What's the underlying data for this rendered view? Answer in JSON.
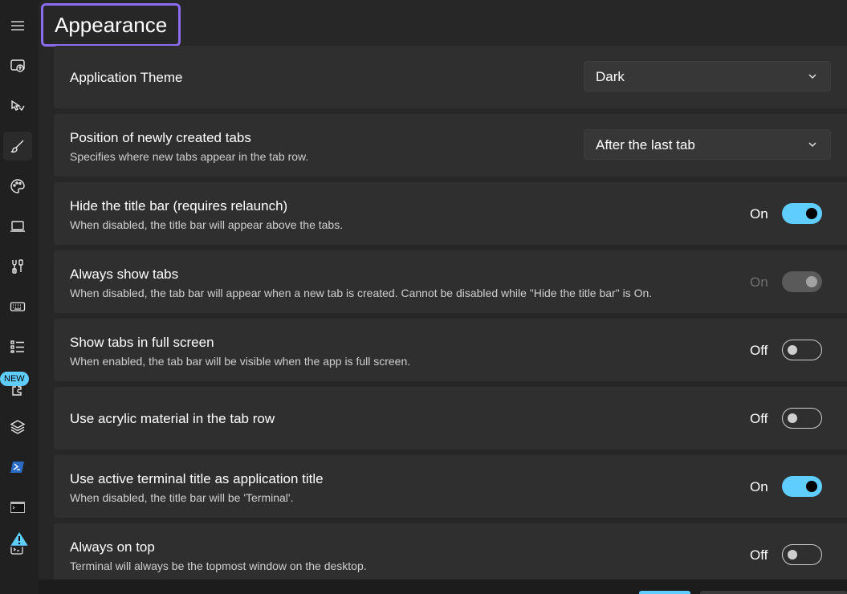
{
  "page": {
    "title": "Appearance"
  },
  "nav": {
    "items": [
      {
        "icon": "hamburger-menu-icon",
        "label": ""
      },
      {
        "icon": "startup-icon",
        "label": ""
      },
      {
        "icon": "interaction-icon",
        "label": ""
      },
      {
        "icon": "brush-icon",
        "label": ""
      },
      {
        "icon": "palette-icon",
        "label": ""
      },
      {
        "icon": "laptop-icon",
        "label": ""
      },
      {
        "icon": "tools-icon",
        "label": ""
      },
      {
        "icon": "keyboard-icon",
        "label": ""
      },
      {
        "icon": "list-icon",
        "label": ""
      },
      {
        "icon": "extension-icon",
        "label": ""
      },
      {
        "icon": "layers-icon",
        "label": ""
      },
      {
        "icon": "powershell-icon",
        "label": ""
      },
      {
        "icon": "command-prompt-icon",
        "label": ""
      },
      {
        "icon": "azure-cloud-shell-icon",
        "label": ""
      }
    ],
    "new_badge": "NEW"
  },
  "settings": [
    {
      "title": "Application Theme",
      "description": "",
      "control": "dropdown",
      "value": "Dark"
    },
    {
      "title": "Position of newly created tabs",
      "description": "Specifies where new tabs appear in the tab row.",
      "control": "dropdown",
      "value": "After the last tab"
    },
    {
      "title": "Hide the title bar (requires relaunch)",
      "description": "When disabled, the title bar will appear above the tabs.",
      "control": "toggle",
      "state": "On",
      "on": true,
      "disabled": false
    },
    {
      "title": "Always show tabs",
      "description": "When disabled, the tab bar will appear when a new tab is created. Cannot be disabled while \"Hide the title bar\" is On.",
      "control": "toggle",
      "state": "On",
      "on": true,
      "disabled": true
    },
    {
      "title": "Show tabs in full screen",
      "description": "When enabled, the tab bar will be visible when the app is full screen.",
      "control": "toggle",
      "state": "Off",
      "on": false,
      "disabled": false
    },
    {
      "title": "Use acrylic material in the tab row",
      "description": "",
      "control": "toggle",
      "state": "Off",
      "on": false,
      "disabled": false
    },
    {
      "title": "Use active terminal title as application title",
      "description": "When disabled, the title bar will be 'Terminal'.",
      "control": "toggle",
      "state": "On",
      "on": true,
      "disabled": false
    },
    {
      "title": "Always on top",
      "description": "Terminal will always be the topmost window on the desktop.",
      "control": "toggle",
      "state": "Off",
      "on": false,
      "disabled": false
    }
  ],
  "colors": {
    "accent": "#60cdff",
    "focus_outline": "#8a6cf0",
    "card": "#2f2f2f",
    "background": "#272727"
  }
}
